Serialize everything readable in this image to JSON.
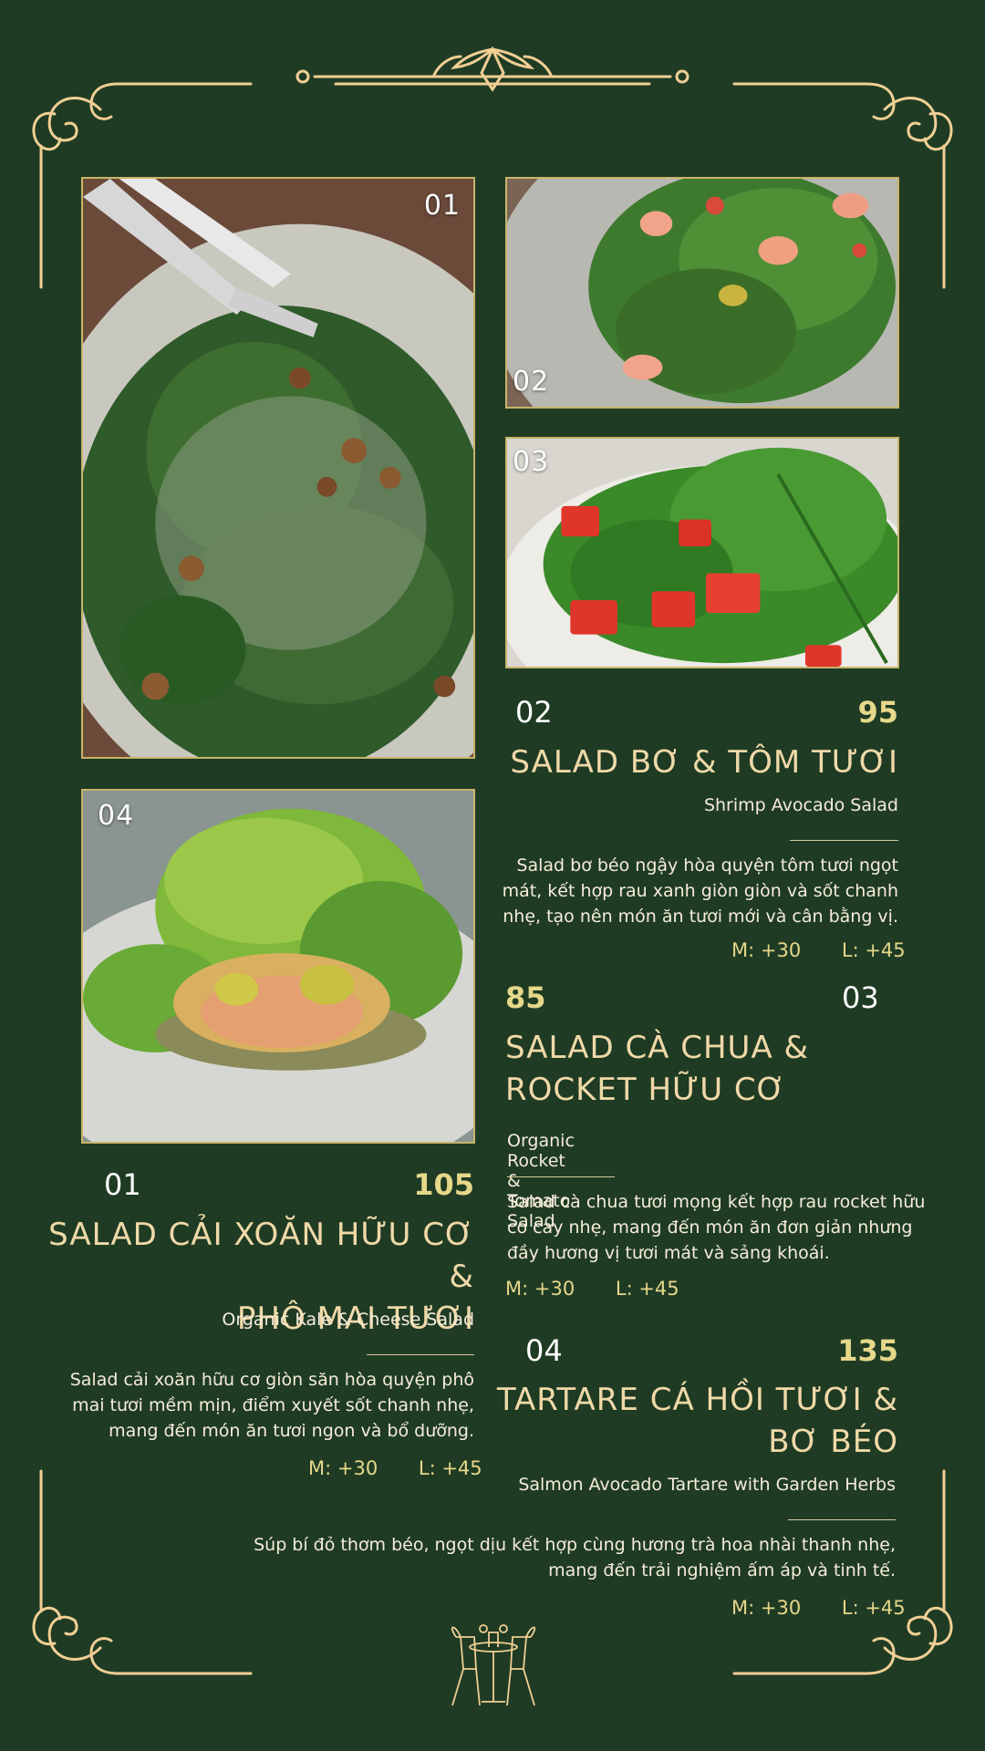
{
  "colors": {
    "background": "#1f3b24",
    "gold": "#e6d78a",
    "cream": "#f0d9a8",
    "frame": "#f0cf94"
  },
  "photos": [
    {
      "num": "01",
      "icon": "kale-cheese-salad-photo"
    },
    {
      "num": "02",
      "icon": "shrimp-avocado-salad-photo"
    },
    {
      "num": "03",
      "icon": "tomato-rocket-salad-photo"
    },
    {
      "num": "04",
      "icon": "salmon-tartare-photo"
    }
  ],
  "items": [
    {
      "index": "01",
      "price": "105",
      "title_line1": "SALAD CẢI XOĂN HỮU CƠ &",
      "title_line2": "PHÔ MAI TƯƠI",
      "subtitle": "Organic Kale & Cheese Salad",
      "desc_line1": "Salad cải xoăn hữu cơ giòn săn hòa quyện phô",
      "desc_line2": "mai tươi mềm mịn, điểm xuyết sốt chanh nhẹ,",
      "desc_line3": "mang đến món ăn tươi ngon và bổ dưỡng.",
      "size_m": "M: +30",
      "size_l": "L: +45"
    },
    {
      "index": "02",
      "price": "95",
      "title_line1": "SALAD BƠ & TÔM TƯƠI",
      "subtitle": "Shrimp Avocado Salad",
      "desc_line1": "Salad bơ béo ngậy hòa quyện tôm tươi ngọt",
      "desc_line2": "mát, kết hợp rau xanh giòn giòn và sốt chanh",
      "desc_line3": "nhẹ, tạo nên món ăn tươi mới và cân bằng vị.",
      "size_m": "M: +30",
      "size_l": "L: +45"
    },
    {
      "index": "03",
      "price": "85",
      "title_line1": "SALAD CÀ CHUA &",
      "title_line2": "ROCKET HỮU CƠ",
      "subtitle": "Organic Rocket & Tomato Salad",
      "desc_line1": "Salad cà chua tươi mọng kết hợp rau rocket hữu",
      "desc_line2": "cơ cay nhẹ, mang đến món ăn đơn giản nhưng",
      "desc_line3": "đầy hương vị tươi mát và sảng khoái.",
      "size_m": "M: +30",
      "size_l": "L: +45"
    },
    {
      "index": "04",
      "price": "135",
      "title_line1": "TARTARE CÁ HỒI TƯƠI &",
      "title_line2": "BƠ BÉO",
      "subtitle": "Salmon Avocado Tartare with Garden Herbs",
      "desc_line1": "Súp bí đỏ thơm béo, ngọt dịu kết hợp cùng hương trà hoa nhài thanh nhẹ,",
      "desc_line2": "mang đến trải nghiệm ấm áp và tinh tế.",
      "size_m": "M: +30",
      "size_l": "L: +45"
    }
  ],
  "footer_icon": "cafe-table-chairs-icon"
}
